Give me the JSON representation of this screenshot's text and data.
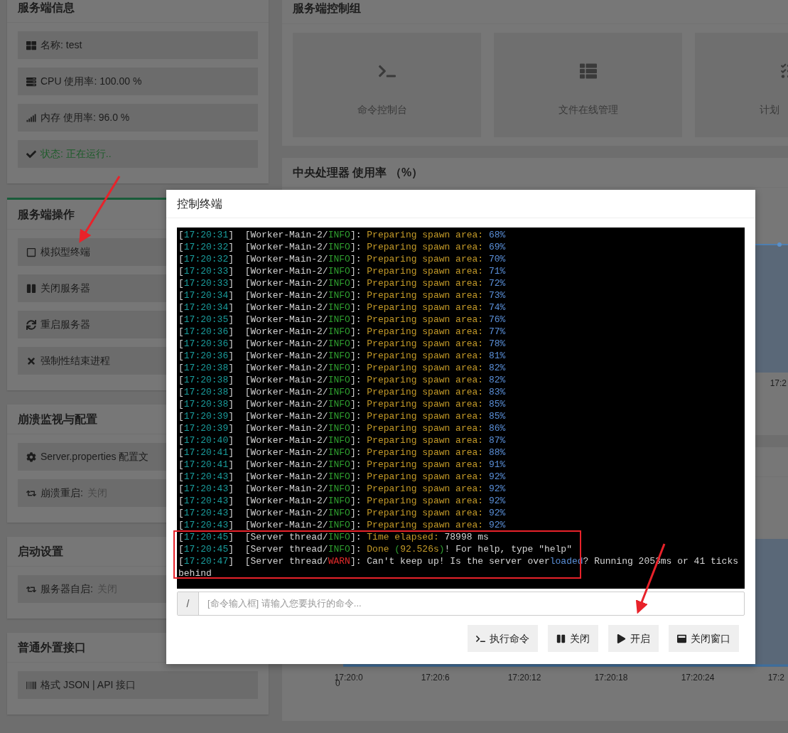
{
  "left_panels": [
    {
      "title": "服务端信息",
      "highlighted": false,
      "items": [
        {
          "label": "名称: test",
          "kind": "plain"
        },
        {
          "label": "CPU 使用率: 100.00 %",
          "kind": "plain"
        },
        {
          "label": "内存 使用率: 96.0 %",
          "kind": "plain"
        },
        {
          "label": "状态: 正在运行..",
          "kind": "status"
        }
      ]
    },
    {
      "title": "服务端操作",
      "highlighted": true,
      "items": [
        {
          "label": "模拟型终端",
          "kind": "plain"
        },
        {
          "label": "关闭服务器",
          "kind": "plain"
        },
        {
          "label": "重启服务器",
          "kind": "plain"
        },
        {
          "label": "强制性结束进程",
          "kind": "plain"
        }
      ]
    },
    {
      "title": "崩溃监视与配置",
      "highlighted": false,
      "items": [
        {
          "label": "Server.properties 配置文",
          "kind": "plain"
        },
        {
          "label": "崩溃重启:",
          "value": "关闭",
          "kind": "toggle"
        }
      ]
    },
    {
      "title": "启动设置",
      "highlighted": false,
      "items": [
        {
          "label": "服务器自启:",
          "value": "关闭",
          "kind": "toggle"
        }
      ]
    },
    {
      "title": "普通外置接口",
      "highlighted": false,
      "items": [
        {
          "label": "格式 JSON | API 接口",
          "kind": "plain"
        }
      ]
    }
  ],
  "control_group": {
    "title": "服务端控制组",
    "tiles": [
      {
        "label": "命令控制台"
      },
      {
        "label": "文件在线管理"
      },
      {
        "label": "计划"
      }
    ]
  },
  "cpu_chart": {
    "title": "中央处理器 使用率 （%）",
    "x_tick": "17:2"
  },
  "lower_chart": {
    "y_tick": "0",
    "x_ticks": [
      "17:20:0",
      "17:20:6",
      "17:20:12",
      "17:20:18",
      "17:20:24",
      "17:2"
    ]
  },
  "terminal_dialog": {
    "title": "控制终端",
    "log": [
      {
        "segments": [
          {
            "text": "[",
            "kind": "plain"
          },
          {
            "text": "17:20:31",
            "kind": "time"
          },
          {
            "text": "]  [Worker-Main-2/",
            "kind": "plain"
          },
          {
            "text": "INFO",
            "kind": "info"
          },
          {
            "text": "]: ",
            "kind": "plain"
          },
          {
            "text": "Preparing spawn area: ",
            "kind": "message"
          },
          {
            "text": "68%",
            "kind": "number"
          }
        ]
      },
      {
        "segments": [
          {
            "text": "[",
            "kind": "plain"
          },
          {
            "text": "17:20:32",
            "kind": "time"
          },
          {
            "text": "]  [Worker-Main-2/",
            "kind": "plain"
          },
          {
            "text": "INFO",
            "kind": "info"
          },
          {
            "text": "]: ",
            "kind": "plain"
          },
          {
            "text": "Preparing spawn area: ",
            "kind": "message"
          },
          {
            "text": "69%",
            "kind": "number"
          }
        ]
      },
      {
        "segments": [
          {
            "text": "[",
            "kind": "plain"
          },
          {
            "text": "17:20:32",
            "kind": "time"
          },
          {
            "text": "]  [Worker-Main-2/",
            "kind": "plain"
          },
          {
            "text": "INFO",
            "kind": "info"
          },
          {
            "text": "]: ",
            "kind": "plain"
          },
          {
            "text": "Preparing spawn area: ",
            "kind": "message"
          },
          {
            "text": "70%",
            "kind": "number"
          }
        ]
      },
      {
        "segments": [
          {
            "text": "[",
            "kind": "plain"
          },
          {
            "text": "17:20:33",
            "kind": "time"
          },
          {
            "text": "]  [Worker-Main-2/",
            "kind": "plain"
          },
          {
            "text": "INFO",
            "kind": "info"
          },
          {
            "text": "]: ",
            "kind": "plain"
          },
          {
            "text": "Preparing spawn area: ",
            "kind": "message"
          },
          {
            "text": "71%",
            "kind": "number"
          }
        ]
      },
      {
        "segments": [
          {
            "text": "[",
            "kind": "plain"
          },
          {
            "text": "17:20:33",
            "kind": "time"
          },
          {
            "text": "]  [Worker-Main-2/",
            "kind": "plain"
          },
          {
            "text": "INFO",
            "kind": "info"
          },
          {
            "text": "]: ",
            "kind": "plain"
          },
          {
            "text": "Preparing spawn area: ",
            "kind": "message"
          },
          {
            "text": "72%",
            "kind": "number"
          }
        ]
      },
      {
        "segments": [
          {
            "text": "[",
            "kind": "plain"
          },
          {
            "text": "17:20:34",
            "kind": "time"
          },
          {
            "text": "]  [Worker-Main-2/",
            "kind": "plain"
          },
          {
            "text": "INFO",
            "kind": "info"
          },
          {
            "text": "]: ",
            "kind": "plain"
          },
          {
            "text": "Preparing spawn area: ",
            "kind": "message"
          },
          {
            "text": "73%",
            "kind": "number"
          }
        ]
      },
      {
        "segments": [
          {
            "text": "[",
            "kind": "plain"
          },
          {
            "text": "17:20:34",
            "kind": "time"
          },
          {
            "text": "]  [Worker-Main-2/",
            "kind": "plain"
          },
          {
            "text": "INFO",
            "kind": "info"
          },
          {
            "text": "]: ",
            "kind": "plain"
          },
          {
            "text": "Preparing spawn area: ",
            "kind": "message"
          },
          {
            "text": "74%",
            "kind": "number"
          }
        ]
      },
      {
        "segments": [
          {
            "text": "[",
            "kind": "plain"
          },
          {
            "text": "17:20:35",
            "kind": "time"
          },
          {
            "text": "]  [Worker-Main-2/",
            "kind": "plain"
          },
          {
            "text": "INFO",
            "kind": "info"
          },
          {
            "text": "]: ",
            "kind": "plain"
          },
          {
            "text": "Preparing spawn area: ",
            "kind": "message"
          },
          {
            "text": "76%",
            "kind": "number"
          }
        ]
      },
      {
        "segments": [
          {
            "text": "[",
            "kind": "plain"
          },
          {
            "text": "17:20:36",
            "kind": "time"
          },
          {
            "text": "]  [Worker-Main-2/",
            "kind": "plain"
          },
          {
            "text": "INFO",
            "kind": "info"
          },
          {
            "text": "]: ",
            "kind": "plain"
          },
          {
            "text": "Preparing spawn area: ",
            "kind": "message"
          },
          {
            "text": "77%",
            "kind": "number"
          }
        ]
      },
      {
        "segments": [
          {
            "text": "[",
            "kind": "plain"
          },
          {
            "text": "17:20:36",
            "kind": "time"
          },
          {
            "text": "]  [Worker-Main-2/",
            "kind": "plain"
          },
          {
            "text": "INFO",
            "kind": "info"
          },
          {
            "text": "]: ",
            "kind": "plain"
          },
          {
            "text": "Preparing spawn area: ",
            "kind": "message"
          },
          {
            "text": "78%",
            "kind": "number"
          }
        ]
      },
      {
        "segments": [
          {
            "text": "[",
            "kind": "plain"
          },
          {
            "text": "17:20:36",
            "kind": "time"
          },
          {
            "text": "]  [Worker-Main-2/",
            "kind": "plain"
          },
          {
            "text": "INFO",
            "kind": "info"
          },
          {
            "text": "]: ",
            "kind": "plain"
          },
          {
            "text": "Preparing spawn area: ",
            "kind": "message"
          },
          {
            "text": "81%",
            "kind": "number"
          }
        ]
      },
      {
        "segments": [
          {
            "text": "[",
            "kind": "plain"
          },
          {
            "text": "17:20:38",
            "kind": "time"
          },
          {
            "text": "]  [Worker-Main-2/",
            "kind": "plain"
          },
          {
            "text": "INFO",
            "kind": "info"
          },
          {
            "text": "]: ",
            "kind": "plain"
          },
          {
            "text": "Preparing spawn area: ",
            "kind": "message"
          },
          {
            "text": "82%",
            "kind": "number"
          }
        ]
      },
      {
        "segments": [
          {
            "text": "[",
            "kind": "plain"
          },
          {
            "text": "17:20:38",
            "kind": "time"
          },
          {
            "text": "]  [Worker-Main-2/",
            "kind": "plain"
          },
          {
            "text": "INFO",
            "kind": "info"
          },
          {
            "text": "]: ",
            "kind": "plain"
          },
          {
            "text": "Preparing spawn area: ",
            "kind": "message"
          },
          {
            "text": "82%",
            "kind": "number"
          }
        ]
      },
      {
        "segments": [
          {
            "text": "[",
            "kind": "plain"
          },
          {
            "text": "17:20:38",
            "kind": "time"
          },
          {
            "text": "]  [Worker-Main-2/",
            "kind": "plain"
          },
          {
            "text": "INFO",
            "kind": "info"
          },
          {
            "text": "]: ",
            "kind": "plain"
          },
          {
            "text": "Preparing spawn area: ",
            "kind": "message"
          },
          {
            "text": "83%",
            "kind": "number"
          }
        ]
      },
      {
        "segments": [
          {
            "text": "[",
            "kind": "plain"
          },
          {
            "text": "17:20:38",
            "kind": "time"
          },
          {
            "text": "]  [Worker-Main-2/",
            "kind": "plain"
          },
          {
            "text": "INFO",
            "kind": "info"
          },
          {
            "text": "]: ",
            "kind": "plain"
          },
          {
            "text": "Preparing spawn area: ",
            "kind": "message"
          },
          {
            "text": "85%",
            "kind": "number"
          }
        ]
      },
      {
        "segments": [
          {
            "text": "[",
            "kind": "plain"
          },
          {
            "text": "17:20:39",
            "kind": "time"
          },
          {
            "text": "]  [Worker-Main-2/",
            "kind": "plain"
          },
          {
            "text": "INFO",
            "kind": "info"
          },
          {
            "text": "]: ",
            "kind": "plain"
          },
          {
            "text": "Preparing spawn area: ",
            "kind": "message"
          },
          {
            "text": "85%",
            "kind": "number"
          }
        ]
      },
      {
        "segments": [
          {
            "text": "[",
            "kind": "plain"
          },
          {
            "text": "17:20:39",
            "kind": "time"
          },
          {
            "text": "]  [Worker-Main-2/",
            "kind": "plain"
          },
          {
            "text": "INFO",
            "kind": "info"
          },
          {
            "text": "]: ",
            "kind": "plain"
          },
          {
            "text": "Preparing spawn area: ",
            "kind": "message"
          },
          {
            "text": "86%",
            "kind": "number"
          }
        ]
      },
      {
        "segments": [
          {
            "text": "[",
            "kind": "plain"
          },
          {
            "text": "17:20:40",
            "kind": "time"
          },
          {
            "text": "]  [Worker-Main-2/",
            "kind": "plain"
          },
          {
            "text": "INFO",
            "kind": "info"
          },
          {
            "text": "]: ",
            "kind": "plain"
          },
          {
            "text": "Preparing spawn area: ",
            "kind": "message"
          },
          {
            "text": "87%",
            "kind": "number"
          }
        ]
      },
      {
        "segments": [
          {
            "text": "[",
            "kind": "plain"
          },
          {
            "text": "17:20:41",
            "kind": "time"
          },
          {
            "text": "]  [Worker-Main-2/",
            "kind": "plain"
          },
          {
            "text": "INFO",
            "kind": "info"
          },
          {
            "text": "]: ",
            "kind": "plain"
          },
          {
            "text": "Preparing spawn area: ",
            "kind": "message"
          },
          {
            "text": "88%",
            "kind": "number"
          }
        ]
      },
      {
        "segments": [
          {
            "text": "[",
            "kind": "plain"
          },
          {
            "text": "17:20:41",
            "kind": "time"
          },
          {
            "text": "]  [Worker-Main-2/",
            "kind": "plain"
          },
          {
            "text": "INFO",
            "kind": "info"
          },
          {
            "text": "]: ",
            "kind": "plain"
          },
          {
            "text": "Preparing spawn area: ",
            "kind": "message"
          },
          {
            "text": "91%",
            "kind": "number"
          }
        ]
      },
      {
        "segments": [
          {
            "text": "[",
            "kind": "plain"
          },
          {
            "text": "17:20:43",
            "kind": "time"
          },
          {
            "text": "]  [Worker-Main-2/",
            "kind": "plain"
          },
          {
            "text": "INFO",
            "kind": "info"
          },
          {
            "text": "]: ",
            "kind": "plain"
          },
          {
            "text": "Preparing spawn area: ",
            "kind": "message"
          },
          {
            "text": "92%",
            "kind": "number"
          }
        ]
      },
      {
        "segments": [
          {
            "text": "[",
            "kind": "plain"
          },
          {
            "text": "17:20:43",
            "kind": "time"
          },
          {
            "text": "]  [Worker-Main-2/",
            "kind": "plain"
          },
          {
            "text": "INFO",
            "kind": "info"
          },
          {
            "text": "]: ",
            "kind": "plain"
          },
          {
            "text": "Preparing spawn area: ",
            "kind": "message"
          },
          {
            "text": "92%",
            "kind": "number"
          }
        ]
      },
      {
        "segments": [
          {
            "text": "[",
            "kind": "plain"
          },
          {
            "text": "17:20:43",
            "kind": "time"
          },
          {
            "text": "]  [Worker-Main-2/",
            "kind": "plain"
          },
          {
            "text": "INFO",
            "kind": "info"
          },
          {
            "text": "]: ",
            "kind": "plain"
          },
          {
            "text": "Preparing spawn area: ",
            "kind": "message"
          },
          {
            "text": "92%",
            "kind": "number"
          }
        ]
      },
      {
        "segments": [
          {
            "text": "[",
            "kind": "plain"
          },
          {
            "text": "17:20:43",
            "kind": "time"
          },
          {
            "text": "]  [Worker-Main-2/",
            "kind": "plain"
          },
          {
            "text": "INFO",
            "kind": "info"
          },
          {
            "text": "]: ",
            "kind": "plain"
          },
          {
            "text": "Preparing spawn area: ",
            "kind": "message"
          },
          {
            "text": "92%",
            "kind": "number"
          }
        ]
      },
      {
        "segments": [
          {
            "text": "[",
            "kind": "plain"
          },
          {
            "text": "17:20:43",
            "kind": "time"
          },
          {
            "text": "]  [Worker-Main-2/",
            "kind": "plain"
          },
          {
            "text": "INFO",
            "kind": "info"
          },
          {
            "text": "]: ",
            "kind": "plain"
          },
          {
            "text": "Preparing spawn area: ",
            "kind": "message"
          },
          {
            "text": "92%",
            "kind": "number"
          }
        ]
      },
      {
        "segments": [
          {
            "text": "[",
            "kind": "plain"
          },
          {
            "text": "17:20:45",
            "kind": "time"
          },
          {
            "text": "]  [Server thread/",
            "kind": "plain"
          },
          {
            "text": "INFO",
            "kind": "info"
          },
          {
            "text": "]: ",
            "kind": "plain"
          },
          {
            "text": "Time elapsed: ",
            "kind": "message"
          },
          {
            "text": "78998 ms",
            "kind": "plain"
          }
        ]
      },
      {
        "segments": [
          {
            "text": "[",
            "kind": "plain"
          },
          {
            "text": "17:20:45",
            "kind": "time"
          },
          {
            "text": "]  [Server thread/",
            "kind": "plain"
          },
          {
            "text": "INFO",
            "kind": "info"
          },
          {
            "text": "]: ",
            "kind": "plain"
          },
          {
            "text": "Done ",
            "kind": "message"
          },
          {
            "text": "(",
            "kind": "info"
          },
          {
            "text": "92.526s",
            "kind": "message"
          },
          {
            "text": ")",
            "kind": "info"
          },
          {
            "text": "! For help, type \"help\"",
            "kind": "plain"
          }
        ]
      },
      {
        "segments": [
          {
            "text": "[",
            "kind": "plain"
          },
          {
            "text": "17:20:47",
            "kind": "time"
          },
          {
            "text": "]  [Server thread/",
            "kind": "plain"
          },
          {
            "text": "WARN",
            "kind": "warn"
          },
          {
            "text": "]: ",
            "kind": "plain"
          },
          {
            "text": "Can't keep up! Is the server over",
            "kind": "plain"
          },
          {
            "text": "loaded",
            "kind": "number"
          },
          {
            "text": "? Running 2053ms or 41 ticks behind",
            "kind": "plain"
          }
        ]
      }
    ],
    "command_prefix": "/",
    "command_placeholder": "[命令输入框] 请输入您要执行的命令...",
    "buttons": [
      {
        "label": "执行命令"
      },
      {
        "label": "关闭"
      },
      {
        "label": "开启"
      },
      {
        "label": "关闭窗口"
      }
    ]
  }
}
